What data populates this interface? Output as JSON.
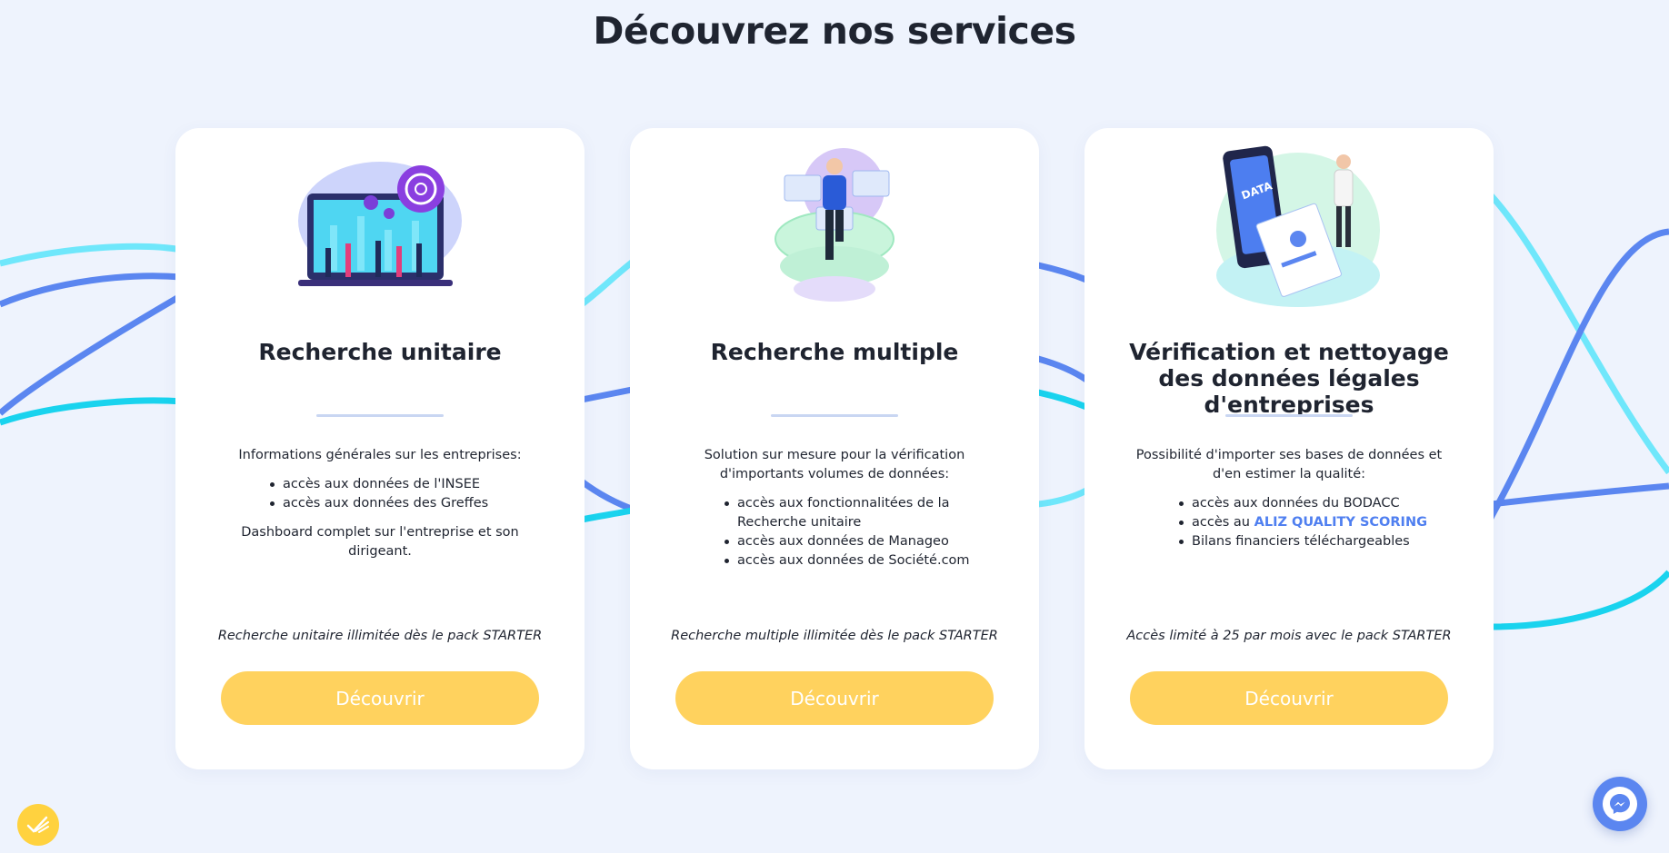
{
  "header": {
    "title": "Découvrez nos services"
  },
  "cards": [
    {
      "title": "Recherche unitaire",
      "illustration": "analytics-team-illustration",
      "intro": "Informations générales sur les entreprises:",
      "bullets": [
        "accès aux données de l'INSEE",
        "accès aux données des Greffes"
      ],
      "outro": "Dashboard complet sur l'entreprise et son dirigeant.",
      "note": "Recherche unitaire illimitée dès le pack STARTER",
      "button": "Découvrir"
    },
    {
      "title": "Recherche multiple",
      "illustration": "data-analyst-illustration",
      "intro": "Solution sur mesure pour la vérification d'importants volumes de données:",
      "bullets": [
        "accès aux fonctionnalitées de la Recherche unitaire",
        "accès aux données de Manageo",
        "accès aux données de Société.com"
      ],
      "note": "Recherche multiple illimitée dès le pack STARTER",
      "button": "Découvrir"
    },
    {
      "title": "Vérification et nettoyage des données légales d'entreprises",
      "illustration": "data-phone-illustration",
      "intro": "Possibilité d'importer ses bases de données et d'en estimer la qualité:",
      "bullets_prefix": [
        "accès aux données du BODACC",
        "accès au ",
        "Bilans financiers téléchargeables"
      ],
      "accent_text": "ALIZ QUALITY SCORING",
      "note": "Accès limité à 25 par mois avec le pack STARTER",
      "button": "Découvrir"
    }
  ],
  "widgets": {
    "left": "feedback-icon",
    "right": "messenger-icon"
  },
  "colors": {
    "background": "#eef3fd",
    "button": "#ffd25e",
    "accent": "#4f7ff0",
    "wave_blue": "#5b86f0",
    "wave_cyan": "#19d3ee",
    "wave_light": "#6fe7fb"
  }
}
